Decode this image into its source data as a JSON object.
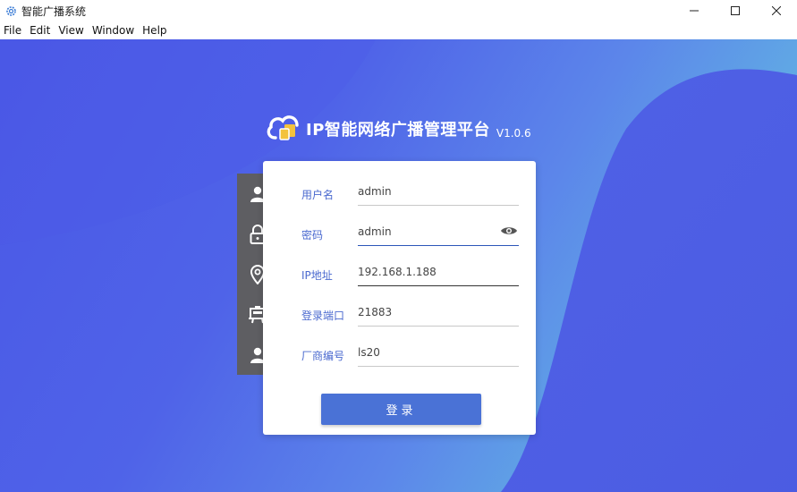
{
  "window": {
    "title": "智能广播系统",
    "controls": {
      "minimize": "—",
      "maximize": "☐",
      "close": "✕"
    }
  },
  "menu": {
    "items": [
      {
        "label": "File"
      },
      {
        "label": "Edit"
      },
      {
        "label": "View"
      },
      {
        "label": "Window"
      },
      {
        "label": "Help"
      }
    ]
  },
  "logo": {
    "title": "IP智能网络广播管理平台",
    "version": "V1.0.6"
  },
  "form": {
    "username": {
      "label": "用户名",
      "value": "admin"
    },
    "password": {
      "label": "密码",
      "value": "admin"
    },
    "ip": {
      "label": "IP地址",
      "value": "192.168.1.188"
    },
    "port": {
      "label": "登录端口",
      "value": "21883"
    },
    "vendor": {
      "label": "厂商编号",
      "value": "ls20"
    },
    "login_label": "登录"
  },
  "icons": {
    "strip": [
      "user-icon",
      "lock-icon",
      "location-pin-icon",
      "device-icon",
      "user-icon"
    ],
    "eye": "eye-icon",
    "app": "gear-icon"
  },
  "colors": {
    "accent": "#4a72d6",
    "label": "#4a69cf",
    "strip": "#5e5e62",
    "bg_start": "#4a58e6",
    "bg_end": "#62cbe0"
  }
}
